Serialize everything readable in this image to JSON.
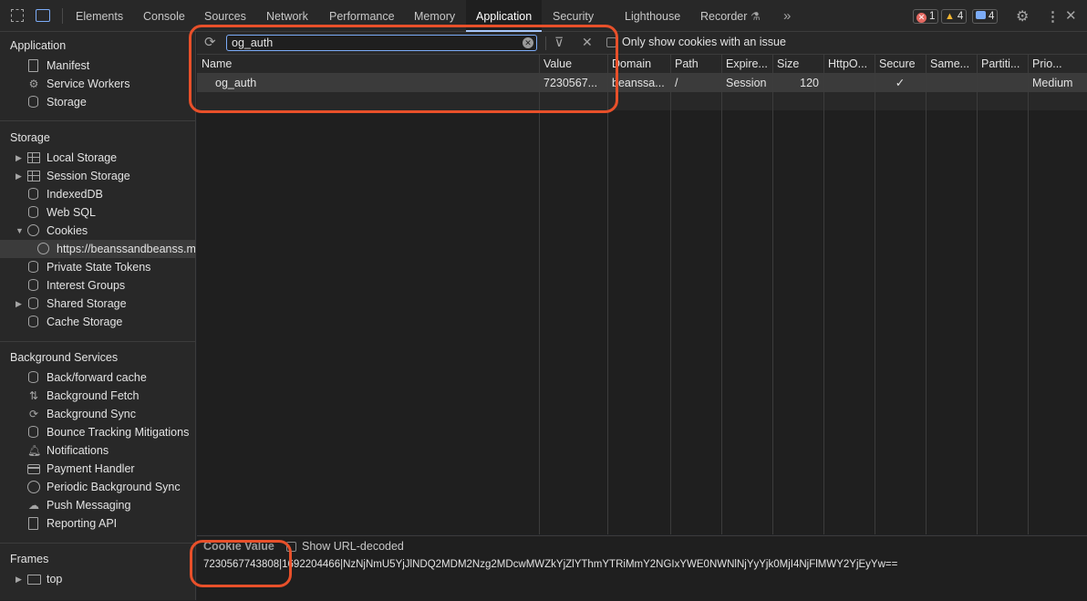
{
  "tabs": [
    "Elements",
    "Console",
    "Sources",
    "Network",
    "Performance",
    "Memory",
    "Application",
    "Security",
    "Lighthouse",
    "Recorder"
  ],
  "active_tab": "Application",
  "badges": {
    "errors": "1",
    "warnings": "4",
    "messages": "4"
  },
  "sidebar": {
    "application_title": "Application",
    "application_items": [
      "Manifest",
      "Service Workers",
      "Storage"
    ],
    "storage_title": "Storage",
    "storage_items": [
      "Local Storage",
      "Session Storage",
      "IndexedDB",
      "Web SQL",
      "Cookies",
      "https://beanssandbeanss.my",
      "Private State Tokens",
      "Interest Groups",
      "Shared Storage",
      "Cache Storage"
    ],
    "background_title": "Background Services",
    "background_items": [
      "Back/forward cache",
      "Background Fetch",
      "Background Sync",
      "Bounce Tracking Mitigations",
      "Notifications",
      "Payment Handler",
      "Periodic Background Sync",
      "Push Messaging",
      "Reporting API"
    ],
    "frames_title": "Frames",
    "frames_items": [
      "top"
    ]
  },
  "toolbar": {
    "filter_value": "og_auth",
    "only_issues_label": "Only show cookies with an issue"
  },
  "table": {
    "columns": [
      "Name",
      "Value",
      "Domain",
      "Path",
      "Expire...",
      "Size",
      "HttpO...",
      "Secure",
      "Same...",
      "Partiti...",
      "Prio..."
    ],
    "rows": [
      {
        "name": "og_auth",
        "value": "7230567...",
        "domain": "beanssa...",
        "path": "/",
        "expires": "Session",
        "size": "120",
        "httponly": "",
        "secure": "✓",
        "samesite": "",
        "partition": "",
        "priority": "Medium"
      }
    ]
  },
  "value_pane": {
    "title": "Cookie Value",
    "show_decoded_label": "Show URL-decoded",
    "cookie_value": "7230567743808|1692204466|NzNjNmU5YjJlNDQ2MDM2Nzg2MDcwMWZkYjZlYThmYTRiMmY2NGIxYWE0NWNlNjYyYjk0MjI4NjFlMWY2YjEyYw=="
  },
  "colors": {
    "highlight": "#e8502a",
    "accent": "#a8c7fa",
    "error": "#e46962",
    "warning": "#f2b531"
  }
}
